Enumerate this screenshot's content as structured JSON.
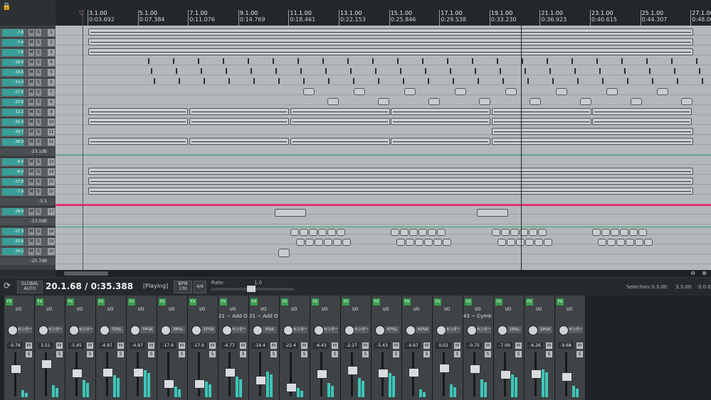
{
  "ruler": {
    "markers": [
      {
        "bar": "3.1.00",
        "time": "0:03.692"
      },
      {
        "bar": "5.1.00",
        "time": "0:07.384"
      },
      {
        "bar": "7.1.00",
        "time": "0:11.076"
      },
      {
        "bar": "9.1.00",
        "time": "0:14.769"
      },
      {
        "bar": "11.1.00",
        "time": "0:18.461"
      },
      {
        "bar": "13.1.00",
        "time": "0:22.153"
      },
      {
        "bar": "15.1.00",
        "time": "0:25.846"
      },
      {
        "bar": "17.1.00",
        "time": "0:29.538"
      },
      {
        "bar": "19.1.00",
        "time": "0:33.230"
      },
      {
        "bar": "21.1.00",
        "time": "0:36.923"
      },
      {
        "bar": "23.1.00",
        "time": "0:40.615"
      },
      {
        "bar": "25.1.00",
        "time": "0:44.307"
      },
      {
        "bar": "27.1.00",
        "time": "0:48.00"
      }
    ]
  },
  "tracks": {
    "rows": [
      {
        "num": "1",
        "vol": "-7.8"
      },
      {
        "num": "2",
        "vol": "-7.4"
      },
      {
        "num": "3",
        "vol": "-7.8"
      },
      {
        "num": "4",
        "vol": "-18.0"
      },
      {
        "num": "5",
        "vol": "-33.6"
      },
      {
        "num": "6",
        "vol": "-14.3"
      },
      {
        "num": "7",
        "vol": "-27.6"
      },
      {
        "num": "8",
        "vol": "-27.6"
      },
      {
        "num": "9",
        "vol": "-12.2"
      },
      {
        "num": "10",
        "vol": "-31.4"
      },
      {
        "num": "11",
        "vol": "-34.7"
      },
      {
        "num": "12",
        "vol": "-36.9"
      }
    ],
    "env1": "-23.1dB",
    "rows2": [
      {
        "num": "13",
        "vol": "-6.0"
      },
      {
        "num": "14",
        "vol": "-8.0"
      },
      {
        "num": "15",
        "vol": "-27.8"
      },
      {
        "num": "16",
        "vol": "-7.9"
      }
    ],
    "env2": "-5.5",
    "rows3": [
      {
        "num": "17",
        "vol": "-28.4"
      }
    ],
    "env3": "-23.0dB",
    "rows4": [
      {
        "num": "18",
        "vol": "-27.3"
      },
      {
        "num": "19",
        "vol": "-32.6"
      },
      {
        "num": "20",
        "vol": "-34.2"
      }
    ],
    "env4": "-25.7dB"
  },
  "transport": {
    "global_auto": "GLOBAL AUTO",
    "time": "20.1.68 / 0:35.388",
    "state": "[Playing]",
    "bpm_label": "BPM",
    "bpm": "130",
    "sig": "4/4",
    "rate_label": "Rate:",
    "rate": "1.0",
    "selection_label": "Selection:",
    "sel_start": "3.3.00",
    "sel_end": "3.3.00",
    "sel_len": "0.0.00"
  },
  "mixer": {
    "fx_label": "FX",
    "io_label": "I/O",
    "pan_label": "センター",
    "m": "M",
    "s": "S",
    "strips": [
      {
        "name": "",
        "pan": "センター",
        "vol": "-0.76"
      },
      {
        "name": "",
        "pan": "センター",
        "vol": "5.51"
      },
      {
        "name": "",
        "pan": "センター",
        "vol": "-5.45"
      },
      {
        "name": "",
        "pan": "72%L",
        "vol": "-4.97"
      },
      {
        "name": "",
        "pan": "74%R",
        "vol": "-4.97"
      },
      {
        "name": "",
        "pan": "38%L",
        "vol": "-17.9"
      },
      {
        "name": "",
        "pan": "37%R",
        "vol": "-17.9"
      },
      {
        "name": "21 − Add O",
        "pan": "センター",
        "vol": "-4.77"
      },
      {
        "name": "21 − Add O",
        "pan": "8%R",
        "vol": "-14.4"
      },
      {
        "name": "",
        "pan": "センター",
        "vol": "-22.4"
      },
      {
        "name": "",
        "pan": "センター",
        "vol": "-6.43"
      },
      {
        "name": "",
        "pan": "センター",
        "vol": "-2.27"
      },
      {
        "name": "",
        "pan": "47%L",
        "vol": "-5.43"
      },
      {
        "name": "",
        "pan": "42%R",
        "vol": "-4.67"
      },
      {
        "name": "",
        "pan": "センター",
        "vol": "0.02"
      },
      {
        "name": "43 − Cymb",
        "pan": "センター",
        "vol": "-0.75"
      },
      {
        "name": "",
        "pan": "19%L",
        "vol": "-7.09"
      },
      {
        "name": "",
        "pan": "19%R",
        "vol": "-6.26"
      },
      {
        "name": "",
        "pan": "センター",
        "vol": "-9.68"
      }
    ]
  },
  "colors": {
    "accent": "#3ec6b9",
    "envelope": "#e8336f",
    "fx_green": "#3a9e50"
  }
}
